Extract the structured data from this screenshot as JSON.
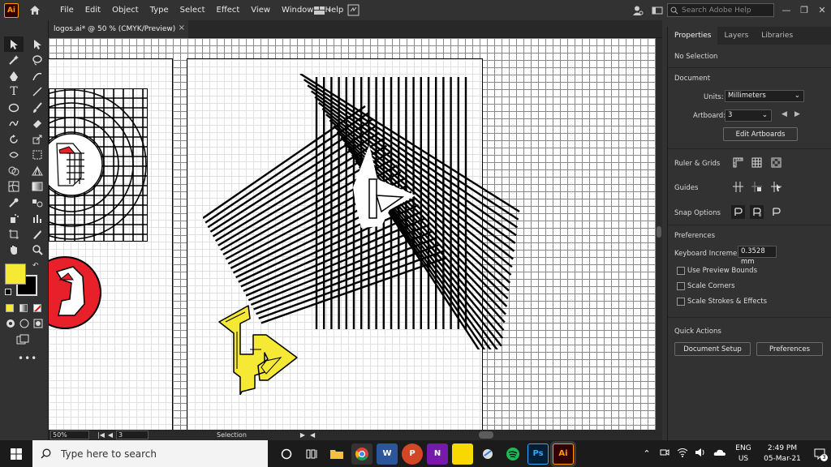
{
  "app": {
    "logo": "Ai",
    "accent": "#ff9a00"
  },
  "menu": [
    "File",
    "Edit",
    "Object",
    "Type",
    "Select",
    "Effect",
    "View",
    "Window",
    "Help"
  ],
  "search": {
    "placeholder": "Search Adobe Help"
  },
  "tab": {
    "title": "logos.ai* @ 50 % (CMYK/Preview)",
    "close": "×"
  },
  "colors": {
    "fill": "#f5e935",
    "stroke": "#000000",
    "red": "#e8202a",
    "yellow": "#f5e935"
  },
  "status": {
    "zoom": "50%",
    "artboard": "3",
    "tool": "Selection"
  },
  "panel": {
    "tabs": [
      "Properties",
      "Layers",
      "Libraries"
    ],
    "selection": "No Selection",
    "document_heading": "Document",
    "units_label": "Units:",
    "units_value": "Millimeters",
    "artboard_label": "Artboard:",
    "artboard_value": "3",
    "edit_artboards": "Edit Artboards",
    "ruler_grids": "Ruler & Grids",
    "guides": "Guides",
    "snap_options": "Snap Options",
    "preferences_heading": "Preferences",
    "keyboard_increment_label": "Keyboard Increment:",
    "keyboard_increment_value": "0.3528 mm",
    "checkboxes": [
      "Use Preview Bounds",
      "Scale Corners",
      "Scale Strokes & Effects"
    ],
    "quick_actions": "Quick Actions",
    "document_setup": "Document Setup",
    "preferences_button": "Preferences"
  },
  "taskbar": {
    "search_placeholder": "Type here to search",
    "lang": "ENG",
    "region": "US",
    "time": "2:49 PM",
    "date": "05-Mar-21",
    "notifications": "3"
  }
}
